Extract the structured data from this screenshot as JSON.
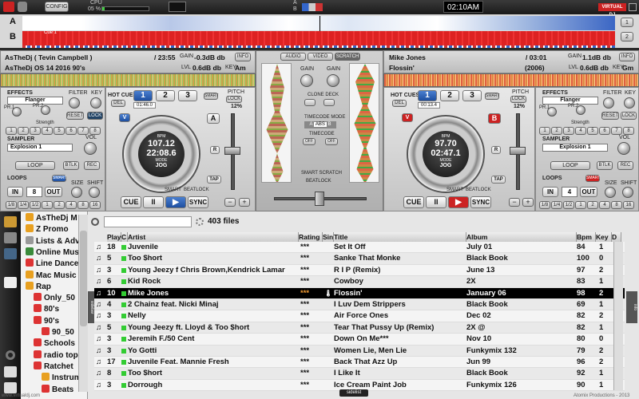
{
  "topbar": {
    "config_label": "CONFIG",
    "cpu_label": "CPU",
    "cpu_value": "05 %",
    "clock": "02:10AM",
    "brand": "VIRTUAL DJ",
    "ab_a": "A",
    "ab_b": "B"
  },
  "overview": {
    "deck_a": "A",
    "deck_b": "B",
    "cue_label": "Cue 1",
    "page1": "1",
    "page2": "2"
  },
  "deckA": {
    "artist": "AsTheDj ( Tevin Campbell )",
    "time": "/ 23:55",
    "title": "AsTheDj OS 14 2016 90's",
    "gain_label": "GAIN",
    "gain_value": "-0.3dB db",
    "lvl_label": "LVL",
    "lvl_value": "0.6dB db",
    "key_label": "KEY",
    "key_value": "Am",
    "info": "INFO",
    "effects_label": "EFFECTS",
    "effect": "Flanger",
    "filter_label": "FILTER",
    "key2_label": "KEY",
    "pr1": "PR.1",
    "pr2": "PR.2",
    "reset": "RESET",
    "lock": "LOCK",
    "strength": "Strength",
    "fx_slots": [
      "1",
      "2",
      "3",
      "4",
      "5",
      "6",
      "7",
      "8"
    ],
    "sampler_label": "SAMPLER",
    "sample": "Explosion 1",
    "vol": "VOL",
    "loop": "LOOP",
    "btlk": "BTLK",
    "rec": "REC",
    "loops_label": "LOOPS",
    "smart": "SMART",
    "size": "SIZE",
    "shift": "SHIFT",
    "in": "IN",
    "loop_len": "8",
    "out": "OUT",
    "loop_fracs": [
      "1/8",
      "1/4",
      "1/2",
      "1",
      "2",
      "4",
      "8",
      "16"
    ],
    "hotcues": "HOT CUES",
    "del": "DEL",
    "cues": [
      "1",
      "2",
      "3"
    ],
    "cue_time": "01:46.0",
    "smart2": "SMART",
    "pitch": "PITCH",
    "lock2": "LOCK",
    "bpm_label": "BPM",
    "bpm": "107.12",
    "remain": "22:08.6",
    "rem": "REM",
    "mode": "MODE",
    "jog": "JOG",
    "pitch_pct": "",
    "deck_letter": "A",
    "v": "V",
    "r": "R",
    "tap": "TAP",
    "minus": "−",
    "plus": "+",
    "cue": "CUE",
    "pause": "II",
    "play": "▶",
    "sync": "SYNC",
    "mode_lbl": "MODE",
    "smart3": "SMART",
    "beatlock": "BEATLOCK"
  },
  "deckB": {
    "artist": "Mike Jones",
    "time": "/ 03:01",
    "title": "Flossin'",
    "year": "(2006)",
    "gain_label": "GAIN",
    "gain_value": "1.1dB db",
    "lvl_label": "LVL",
    "lvl_value": "0.6dB db",
    "key_label": "KEY",
    "key_value": "Gm",
    "info": "INFO",
    "effects_label": "EFFECTS",
    "effect": "Flanger",
    "filter_label": "FILTER",
    "key2_label": "KEY",
    "pr1": "PR.1",
    "pr2": "PR.2",
    "reset": "RESET",
    "lock": "LOCK",
    "strength": "Strength",
    "fx_slots": [
      "1",
      "2",
      "3",
      "4",
      "5",
      "6",
      "7",
      "8"
    ],
    "sampler_label": "SAMPLER",
    "sample": "Explosion 1",
    "vol": "VOL",
    "loop": "LOOP",
    "btlk": "BTLK",
    "rec": "REC",
    "loops_label": "LOOPS",
    "smart": "SMART",
    "size": "SIZE",
    "shift": "SHIFT",
    "in": "IN",
    "loop_len": "4",
    "out": "OUT",
    "loop_fracs": [
      "1/8",
      "1/4",
      "1/2",
      "1",
      "2",
      "4",
      "8",
      "16"
    ],
    "hotcues": "HOT CUES",
    "del": "DEL",
    "cues": [
      "1",
      "2",
      "3"
    ],
    "cue_time": "00:13.4",
    "smart2": "SMART",
    "pitch": "PITCH",
    "lock2": "LOCK",
    "pitch_pct": "12%",
    "bpm_label": "BPM",
    "bpm": "97.70",
    "remain": "02:47.1",
    "rem": "REM",
    "mode": "MODE",
    "jog": "JOG",
    "deck_letter": "B",
    "v": "V",
    "r": "R",
    "tap": "TAP",
    "minus": "−",
    "plus": "+",
    "cue": "CUE",
    "pause": "II",
    "play": "▶",
    "sync": "SYNC",
    "mode_lbl": "MODE",
    "smart3": "SMART",
    "beatlock": "BEATLOCK"
  },
  "deckA_pitch_pct": "12%",
  "mixer": {
    "tabs": [
      "AUDIO",
      "VIDEO",
      "SCRATCH"
    ],
    "gain": "GAIN",
    "clone": "CLONE DECK",
    "timecode_mode": "TIMECODE MODE",
    "tc_a": "A",
    "tc_abs": "ABS",
    "tc_b": "B",
    "timecode": "TIMECODE",
    "off": "OFF",
    "smart_scratch": "SMART SCRATCH",
    "beatlock": "BEATLOCK"
  },
  "browser": {
    "search_placeholder": "",
    "file_count": "403 files",
    "sidelist": "sidelist",
    "footer": "Atomix Productions - 2013",
    "footer_left": "www.virtualdj.com",
    "sidebar_tab": "sidebar",
    "info_tab": "info",
    "columns": {
      "play": "Play",
      "c": "C",
      "artist": "Artist",
      "rating": "Rating",
      "sin": "Sin",
      "title": "Title",
      "album": "Album",
      "bpm": "Bpm",
      "key": "Key",
      "d": "D"
    },
    "tree": [
      {
        "label": "AsTheDj  M",
        "indent": 0,
        "color": "#e8a020"
      },
      {
        "label": "Z Promo",
        "indent": 0,
        "color": "#e8a020"
      },
      {
        "label": "Lists & Adv",
        "indent": 0,
        "color": "#999"
      },
      {
        "label": "Online Musi",
        "indent": 0,
        "color": "#3a8a3a"
      },
      {
        "label": "Line Dance",
        "indent": 0,
        "color": "#d33"
      },
      {
        "label": "Mac Music",
        "indent": 0,
        "color": "#e8a020"
      },
      {
        "label": "Rap",
        "indent": 0,
        "color": "#e8a020"
      },
      {
        "label": "Only_50",
        "indent": 1,
        "color": "#d33"
      },
      {
        "label": "80's",
        "indent": 1,
        "color": "#d33"
      },
      {
        "label": "90's",
        "indent": 1,
        "color": "#d33"
      },
      {
        "label": "90_50",
        "indent": 2,
        "color": "#d33"
      },
      {
        "label": "Schools",
        "indent": 1,
        "color": "#d33"
      },
      {
        "label": "radio top",
        "indent": 1,
        "color": "#d33"
      },
      {
        "label": "Ratchet",
        "indent": 1,
        "color": "#d33"
      },
      {
        "label": "Instrum",
        "indent": 2,
        "color": "#e8a020"
      },
      {
        "label": "Beats",
        "indent": 2,
        "color": "#d33"
      }
    ],
    "rows": [
      {
        "play": "18",
        "artist": "Juvenile",
        "rating": "***",
        "title": "Set It Off",
        "album": "July 01",
        "bpm": "84",
        "key": "1"
      },
      {
        "play": "5",
        "artist": "Too $hort",
        "rating": "***",
        "title": "Sanke That Monke",
        "album": "Black Book",
        "bpm": "100",
        "key": "0"
      },
      {
        "play": "3",
        "artist": "Young Jeezy f Chris Brown,Kendrick Lamar",
        "rating": "***",
        "title": "R I P (Remix)",
        "album": "June 13",
        "bpm": "97",
        "key": "2"
      },
      {
        "play": "6",
        "artist": "Kid Rock",
        "rating": "***",
        "title": "Cowboy",
        "album": "2X",
        "bpm": "83",
        "key": "1"
      },
      {
        "play": "10",
        "artist": "Mike Jones",
        "rating": "***",
        "title": "Flossin'",
        "album": "January 06",
        "bpm": "98",
        "key": "2",
        "sel": true
      },
      {
        "play": "4",
        "artist": "2 Chainz feat. Nicki Minaj",
        "rating": "***",
        "title": "I Luv Dem Strippers",
        "album": "Black Book",
        "bpm": "69",
        "key": "1"
      },
      {
        "play": "3",
        "artist": "Nelly",
        "rating": "***",
        "title": "Air Force Ones",
        "album": "Dec 02",
        "bpm": "82",
        "key": "2"
      },
      {
        "play": "5",
        "artist": "Young Jeezy ft. Lloyd & Too $hort",
        "rating": "***",
        "title": "Tear That  Pussy Up (Remix)",
        "album": "2X @",
        "bpm": "82",
        "key": "1"
      },
      {
        "play": "3",
        "artist": "Jeremih F./50 Cent",
        "rating": "***",
        "title": "Down On Me***",
        "album": "Nov 10",
        "bpm": "80",
        "key": "0"
      },
      {
        "play": "3",
        "artist": "Yo Gotti",
        "rating": "***",
        "title": "Women Lie, Men Lie",
        "album": "Funkymix 132",
        "bpm": "79",
        "key": "2"
      },
      {
        "play": "17",
        "artist": "Juvenile Feat. Mannie Fresh",
        "rating": "***",
        "title": "Back That Azz Up",
        "album": "Jun 99",
        "bpm": "96",
        "key": "2"
      },
      {
        "play": "8",
        "artist": "Too $hort",
        "rating": "***",
        "title": "I Like It",
        "album": "Black Book",
        "bpm": "92",
        "key": "1"
      },
      {
        "play": "3",
        "artist": "Dorrough",
        "rating": "***",
        "title": "Ice Cream Paint Job",
        "album": "Funkymix 126",
        "bpm": "90",
        "key": "1"
      }
    ]
  }
}
